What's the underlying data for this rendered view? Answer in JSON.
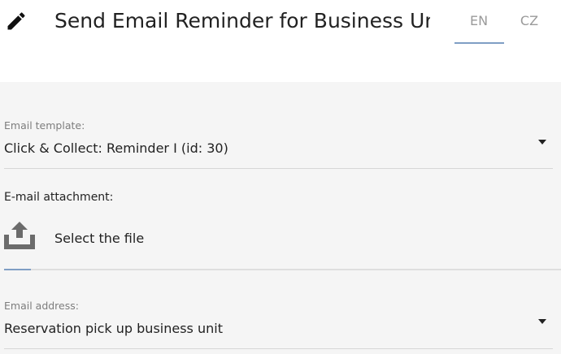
{
  "header": {
    "title": "Send Email Reminder for Business Unit",
    "languages": [
      "EN",
      "CZ"
    ],
    "active_language": "EN"
  },
  "form": {
    "email_template": {
      "label": "Email template:",
      "value": "Click & Collect: Reminder I (id: 30)"
    },
    "attachment": {
      "label": "E-mail attachment:",
      "button_label": "Select the file"
    },
    "email_address": {
      "label": "Email address:",
      "value": "Reservation pick up business unit"
    }
  },
  "colors": {
    "accent": "#7f9ec4",
    "panel_background": "#f5f5f5",
    "icon": "#6b6b6b"
  },
  "icons": [
    "pencil-icon",
    "upload-icon",
    "caret-down-icon"
  ]
}
